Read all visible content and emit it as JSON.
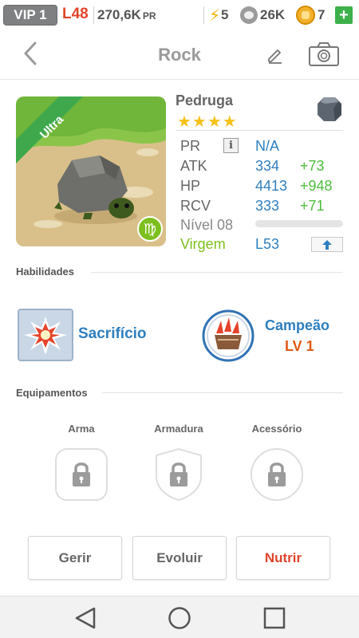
{
  "status": {
    "vip": "VIP 1",
    "level": "L48",
    "pr_total": "270,6K",
    "pr_unit": "PR",
    "energy": "5",
    "paw_currency": "26K",
    "gold_currency": "7",
    "plus": "+"
  },
  "header": {
    "title": "Rock"
  },
  "character": {
    "name": "Pedruga",
    "rarity_badge": "Ultra",
    "stars": "★★★★",
    "element_icon": "rock-element-icon",
    "stats": [
      {
        "label": "PR",
        "value": "N/A",
        "bonus": ""
      },
      {
        "label": "ATK",
        "value": "334",
        "bonus": "+73"
      },
      {
        "label": "HP",
        "value": "4413",
        "bonus": "+948"
      },
      {
        "label": "RCV",
        "value": "333",
        "bonus": "+71"
      }
    ],
    "info_label": "i",
    "level_label": "Nível 08",
    "xp_progress": 0,
    "sign_label": "Virgem",
    "sign_level": "L53",
    "sign_color": "#7dbf1f"
  },
  "abilities": {
    "section_title": "Habilidades",
    "skill_name": "Sacrifício",
    "leader_name": "Campeão",
    "leader_level": "LV 1"
  },
  "equipment": {
    "section_title": "Equipamentos",
    "slots": [
      {
        "label": "Arma",
        "icon": "weapon-lock-icon"
      },
      {
        "label": "Armadura",
        "icon": "armor-lock-icon"
      },
      {
        "label": "Acessório",
        "icon": "accessory-lock-icon"
      }
    ]
  },
  "actions": {
    "manage": "Gerir",
    "evolve": "Evoluir",
    "feed": "Nutrir",
    "feed_color": "#e0452c"
  },
  "colors": {
    "blue_value": "#2e7fc0",
    "green_bonus": "#4fbd3d",
    "title_grey": "#9a9a9a"
  }
}
